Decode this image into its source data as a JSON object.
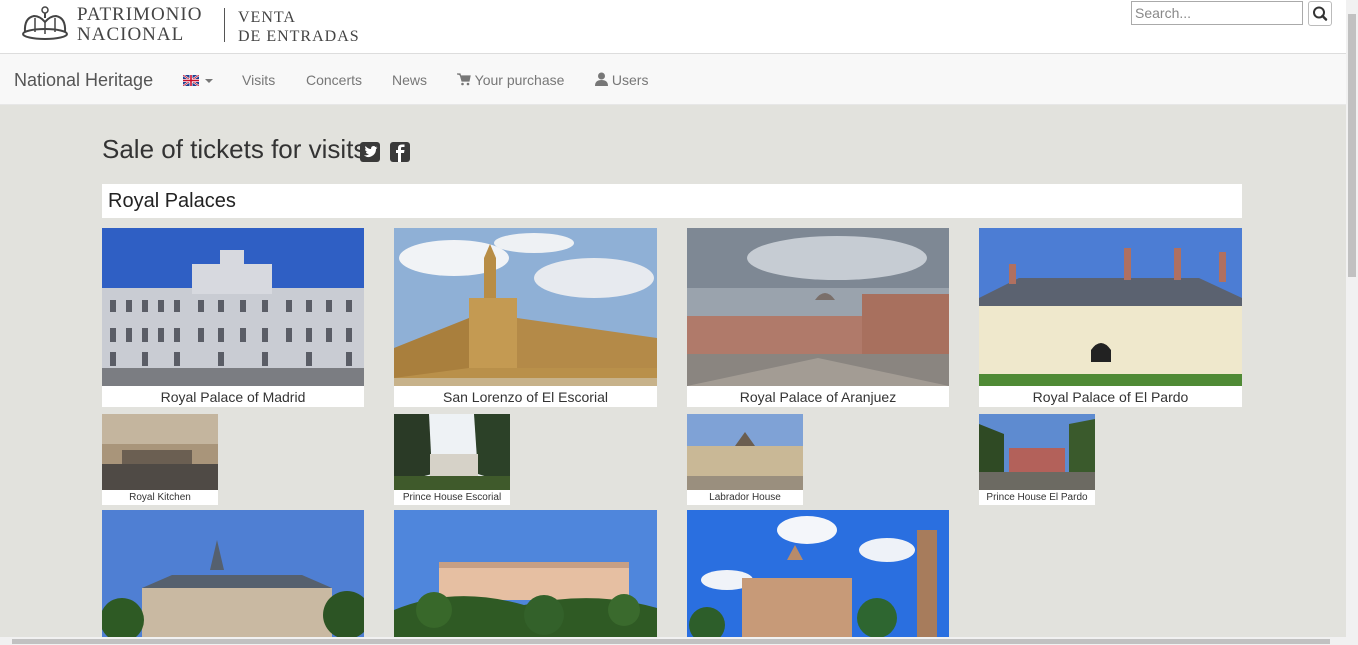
{
  "logo": {
    "line1": "PATRIMONIO",
    "line2": "NACIONAL",
    "line3": "VENTA",
    "line4": "DE ENTRADAS"
  },
  "search": {
    "placeholder": "Search..."
  },
  "nav": {
    "brand": "National Heritage",
    "language_flag": "uk-flag-icon",
    "items": [
      {
        "label": "Visits"
      },
      {
        "label": "Concerts"
      },
      {
        "label": "News"
      },
      {
        "label": "Your purchase",
        "icon": "cart-icon"
      },
      {
        "label": "Users",
        "icon": "user-icon"
      }
    ]
  },
  "page": {
    "title": "Sale of tickets for visits",
    "social": [
      "twitter-icon",
      "facebook-icon"
    ]
  },
  "section": {
    "title": "Royal Palaces"
  },
  "cards_large": [
    {
      "caption": "Royal Palace of Madrid"
    },
    {
      "caption": "San Lorenzo of El Escorial"
    },
    {
      "caption": "Royal Palace of Aranjuez"
    },
    {
      "caption": "Royal Palace of El Pardo"
    }
  ],
  "cards_small": [
    {
      "caption": "Royal Kitchen"
    },
    {
      "caption": "Prince House Escorial"
    },
    {
      "caption": "Labrador House"
    },
    {
      "caption": "Prince House El Pardo"
    }
  ],
  "colors": {
    "nav_bg": "#f8f8f8",
    "page_bg": "#e2e2dd",
    "sky": "#3b6ec9"
  }
}
